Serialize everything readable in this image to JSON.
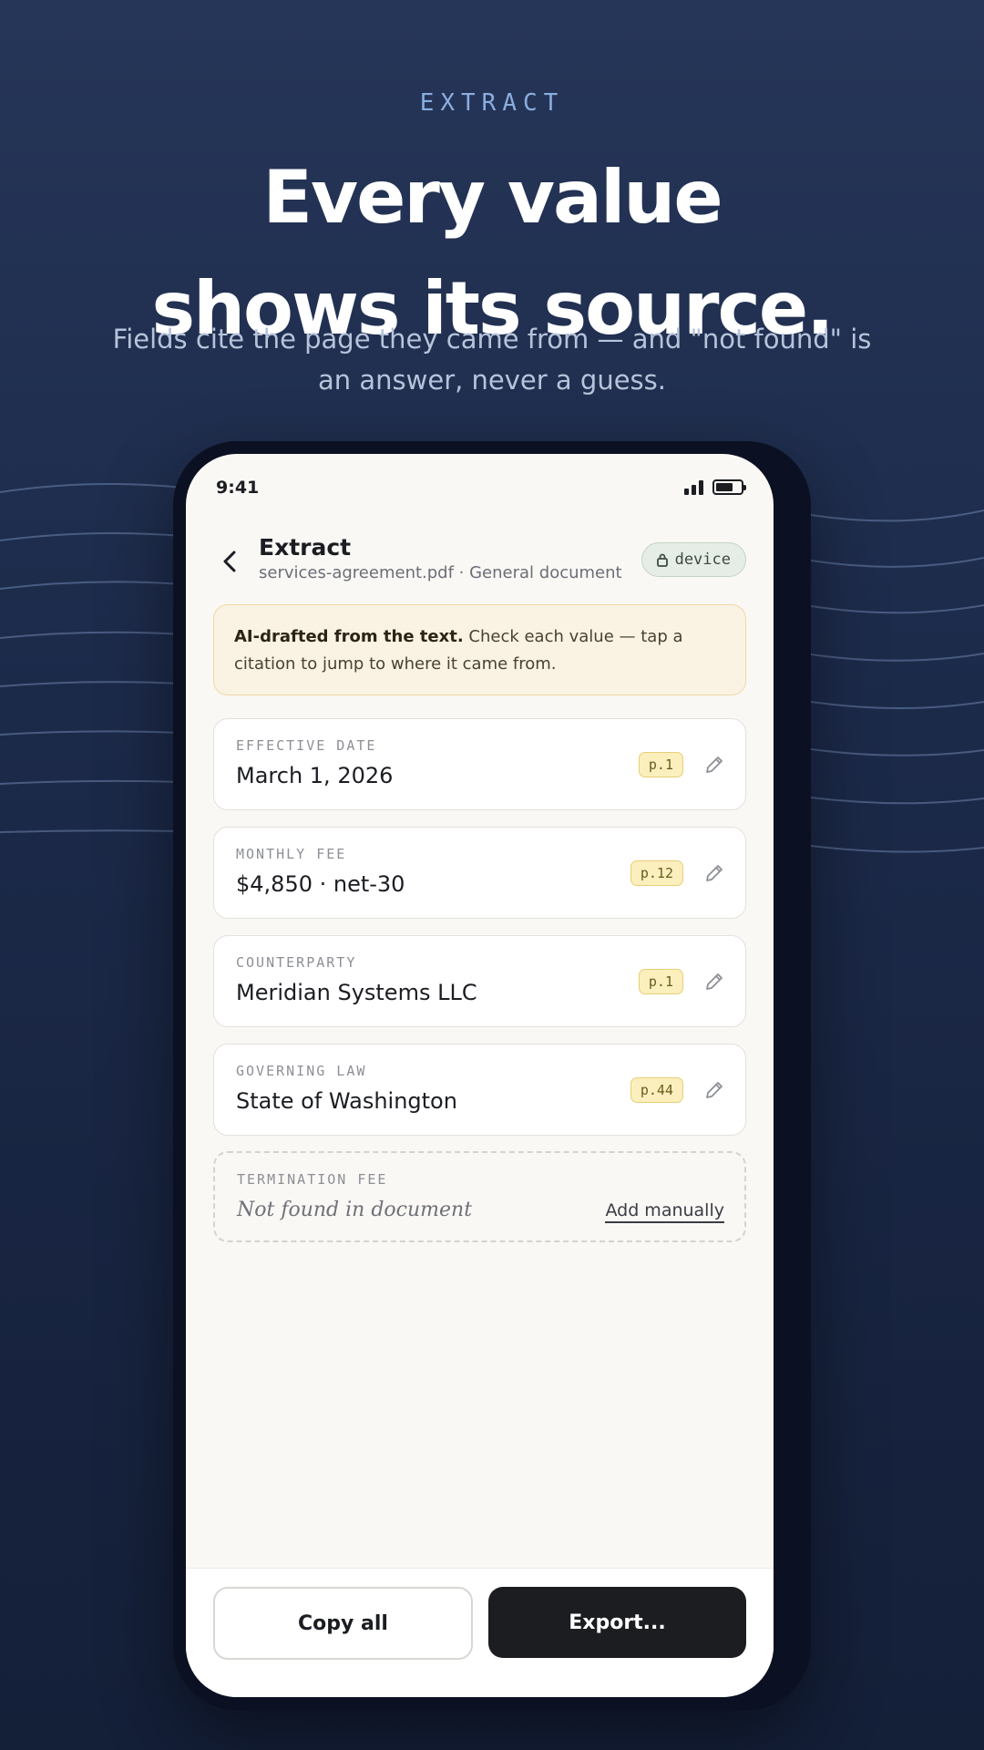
{
  "hero": {
    "eyebrow": "EXTRACT",
    "headline_line1": "Every value",
    "headline_line2": "shows its source.",
    "subhead": "Fields cite the page they came from — and \"not found\" is an answer, never a guess."
  },
  "status_bar": {
    "time": "9:41"
  },
  "header": {
    "title": "Extract",
    "subtitle": "services-agreement.pdf · General document",
    "badge": "device"
  },
  "notice": {
    "bold": "AI-drafted from the text.",
    "text": " Check each value — tap a citation to jump to where it came from."
  },
  "fields": [
    {
      "label": "EFFECTIVE DATE",
      "value": "March 1, 2026",
      "citation": "p.1"
    },
    {
      "label": "MONTHLY FEE",
      "value": "$4,850 · net-30",
      "citation": "p.12"
    },
    {
      "label": "COUNTERPARTY",
      "value": "Meridian Systems LLC",
      "citation": "p.1"
    },
    {
      "label": "GOVERNING LAW",
      "value": "State of Washington",
      "citation": "p.44"
    }
  ],
  "missing_field": {
    "label": "TERMINATION FEE",
    "value": "Not found in document",
    "action": "Add manually"
  },
  "actions": {
    "copy": "Copy all",
    "export": "Export..."
  },
  "colors": {
    "accent": "#8aaee0",
    "citation_bg": "#fbefbd",
    "primary_button": "#1c1d21",
    "badge_bg": "#e6ede6"
  }
}
